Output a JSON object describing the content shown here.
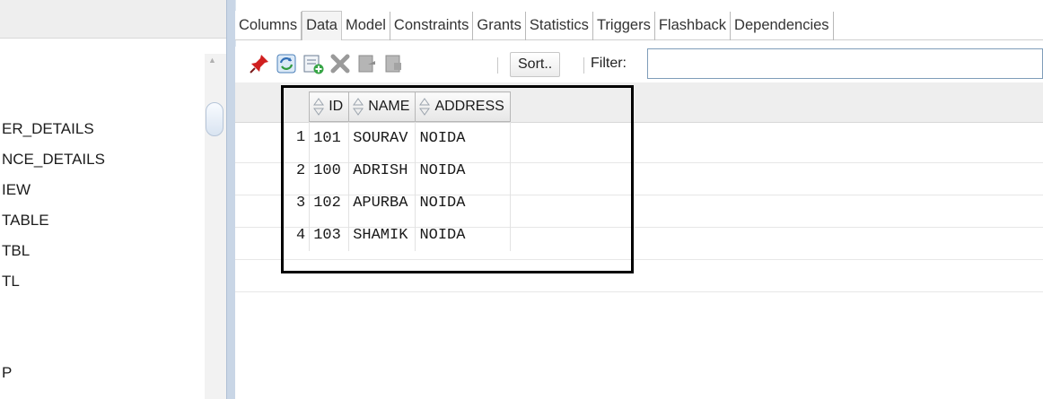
{
  "navigator": {
    "items": [
      "ER_DETAILS",
      "NCE_DETAILS",
      "IEW",
      "TABLE",
      "TBL",
      "TL",
      "P"
    ]
  },
  "tabs": [
    {
      "label": "Columns",
      "active": false
    },
    {
      "label": "Data",
      "active": true
    },
    {
      "label": "Model",
      "active": false
    },
    {
      "label": "Constraints",
      "active": false
    },
    {
      "label": "Grants",
      "active": false
    },
    {
      "label": "Statistics",
      "active": false
    },
    {
      "label": "Triggers",
      "active": false
    },
    {
      "label": "Flashback",
      "active": false
    },
    {
      "label": "Dependencies",
      "active": false
    }
  ],
  "toolbar": {
    "icons": [
      "pin-icon",
      "refresh-icon",
      "insert-row-icon",
      "delete-row-icon",
      "commit-icon",
      "rollback-icon"
    ],
    "sort_label": "Sort..",
    "filter_label": "Filter:",
    "filter_value": ""
  },
  "grid": {
    "columns": [
      "ID",
      "NAME",
      "ADDRESS"
    ],
    "rows": [
      {
        "num": "1",
        "cells": [
          "101",
          "SOURAV",
          "NOIDA"
        ]
      },
      {
        "num": "2",
        "cells": [
          "100",
          "ADRISH",
          "NOIDA"
        ]
      },
      {
        "num": "3",
        "cells": [
          "102",
          "APURBA",
          "NOIDA"
        ]
      },
      {
        "num": "4",
        "cells": [
          "103",
          "SHAMIK",
          "NOIDA"
        ]
      }
    ]
  },
  "colors": {
    "highlight_box": "#000000",
    "splitter": "#c9d6e6",
    "delete_icon": "#9a9a9a",
    "pin_icon": "#d01f1f"
  }
}
